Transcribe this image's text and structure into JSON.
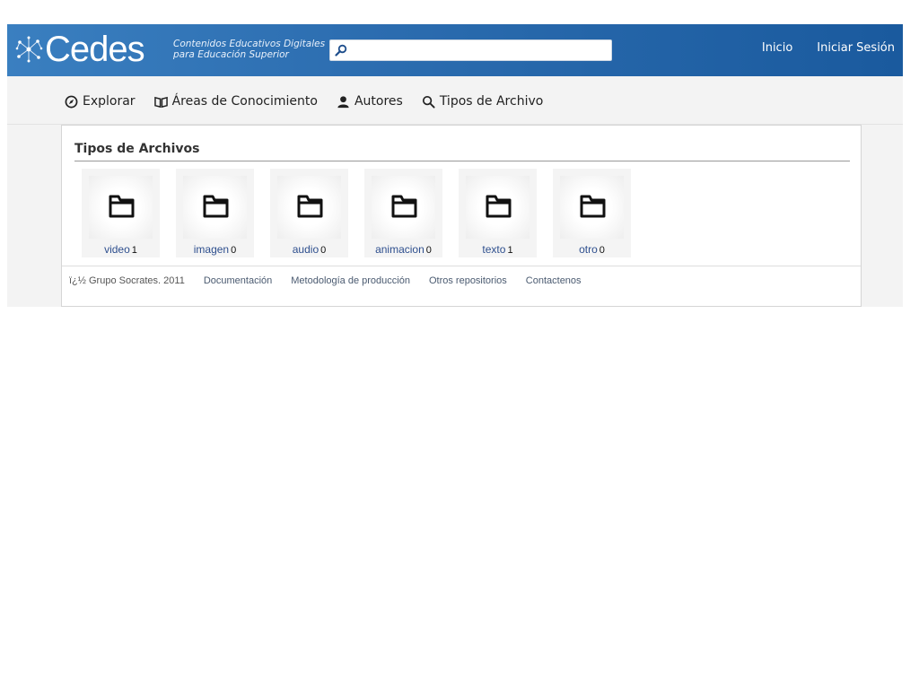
{
  "header": {
    "logo_text": "Cedes",
    "tagline_line1": "Contenidos Educativos Digitales",
    "tagline_line2": "para Educación Superior",
    "search": {
      "value": "",
      "placeholder": ""
    },
    "nav": [
      {
        "label": "Inicio"
      },
      {
        "label": "Iniciar Sesión"
      }
    ]
  },
  "subnav": {
    "items": [
      {
        "label": "Explorar",
        "icon": "compass-icon"
      },
      {
        "label": "Áreas de Conocimiento",
        "icon": "book-icon"
      },
      {
        "label": "Autores",
        "icon": "user-icon"
      },
      {
        "label": "Tipos de Archivo",
        "icon": "search-icon"
      }
    ]
  },
  "main": {
    "title": "Tipos de Archivos",
    "tiles": [
      {
        "label": "video",
        "count": "1"
      },
      {
        "label": "imagen",
        "count": "0"
      },
      {
        "label": "audio",
        "count": "0"
      },
      {
        "label": "animacion",
        "count": "0"
      },
      {
        "label": "texto",
        "count": "1"
      },
      {
        "label": "otro",
        "count": "0"
      }
    ]
  },
  "footer": {
    "copyright": "ï¿½ Grupo Socrates. 2011",
    "links": [
      {
        "label": "Documentación"
      },
      {
        "label": "Metodología de producción"
      },
      {
        "label": "Otros repositorios"
      },
      {
        "label": "Contactenos"
      }
    ]
  }
}
